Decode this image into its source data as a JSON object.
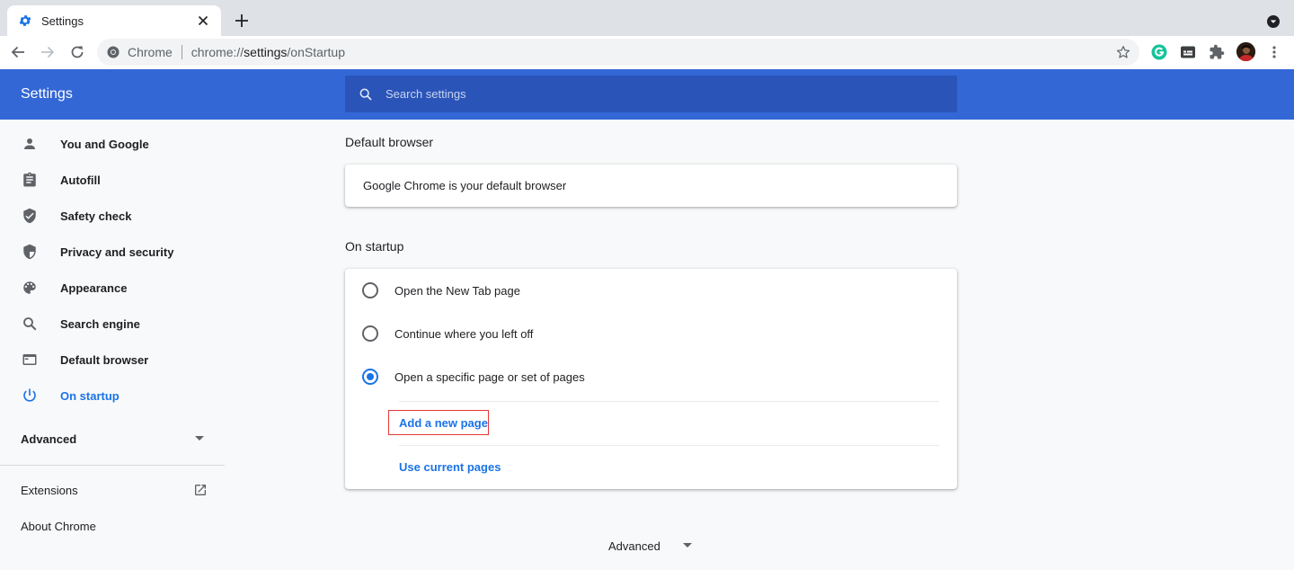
{
  "tab": {
    "title": "Settings"
  },
  "omnibox": {
    "chip": "Chrome",
    "url_prefix": "chrome://",
    "url_host": "settings",
    "url_path": "/onStartup"
  },
  "header": {
    "title": "Settings",
    "search_placeholder": "Search settings"
  },
  "sidebar": {
    "items": [
      {
        "label": "You and Google",
        "icon": "person-icon"
      },
      {
        "label": "Autofill",
        "icon": "clipboard-icon"
      },
      {
        "label": "Safety check",
        "icon": "shield-check-icon"
      },
      {
        "label": "Privacy and security",
        "icon": "shield-icon"
      },
      {
        "label": "Appearance",
        "icon": "palette-icon"
      },
      {
        "label": "Search engine",
        "icon": "search-icon"
      },
      {
        "label": "Default browser",
        "icon": "browser-window-icon"
      },
      {
        "label": "On startup",
        "icon": "power-icon"
      }
    ],
    "advanced": "Advanced",
    "extensions": "Extensions",
    "about": "About Chrome"
  },
  "main": {
    "default_browser": {
      "title": "Default browser",
      "text": "Google Chrome is your default browser"
    },
    "on_startup": {
      "title": "On startup",
      "options": [
        {
          "label": "Open the New Tab page",
          "checked": false
        },
        {
          "label": "Continue where you left off",
          "checked": false
        },
        {
          "label": "Open a specific page or set of pages",
          "checked": true
        }
      ],
      "add_page": "Add a new page",
      "use_current": "Use current pages"
    },
    "advanced": "Advanced"
  },
  "colors": {
    "header": "#3367d6",
    "accent": "#1a73e8",
    "highlight": "#e53935"
  }
}
